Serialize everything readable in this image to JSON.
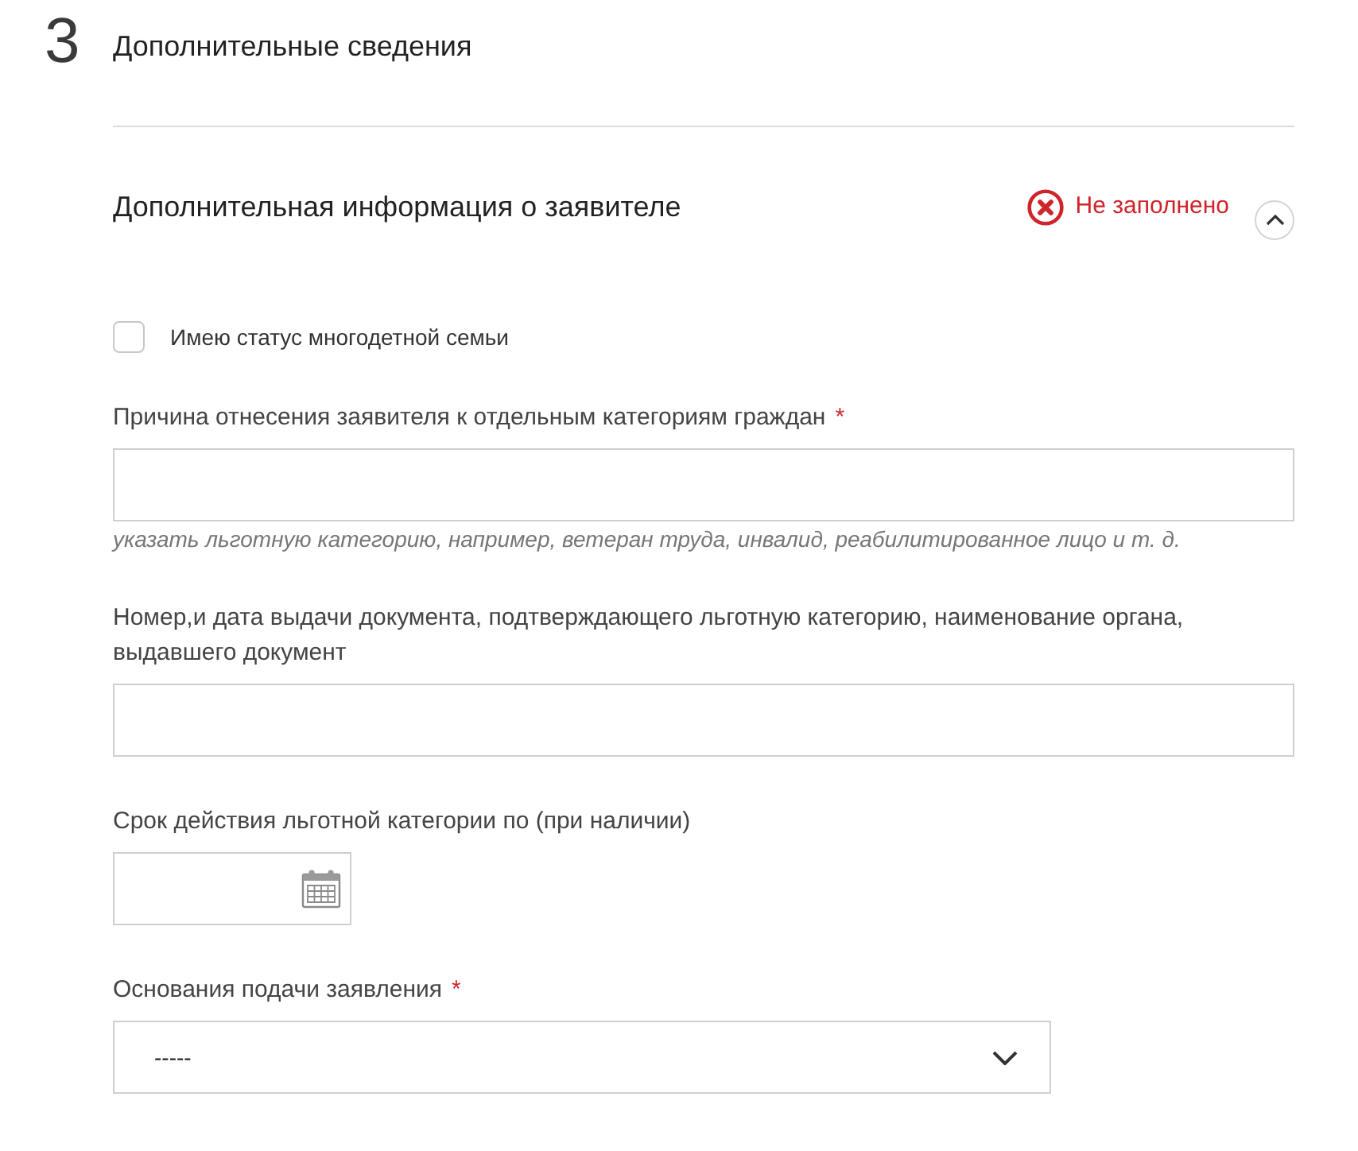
{
  "section": {
    "number": "3",
    "title": "Дополнительные сведения"
  },
  "panel": {
    "title": "Дополнительная информация о заявителе",
    "status": {
      "kind": "error",
      "text": "Не заполнено"
    },
    "expanded": true
  },
  "fields": [
    {
      "kind": "checkbox",
      "label": "Имею статус многодетной семьи",
      "checked": false
    },
    {
      "kind": "text",
      "label": "Причина отнесения заявителя к отдельным категориям граждан",
      "required_mark": "*",
      "hint": "указать льготную категорию, например, ветеран труда, инвалид, реабилитированное лицо и т. д."
    },
    {
      "kind": "text",
      "label": "Номер,и дата выдачи документа, подтверждающего льготную категорию, наименование органа, выдавшего документ"
    },
    {
      "kind": "date",
      "label": "Срок действия льготной категории по (при наличии)"
    },
    {
      "kind": "select",
      "label": "Основания подачи заявления",
      "required_mark": "*",
      "value": "-----"
    }
  ]
}
